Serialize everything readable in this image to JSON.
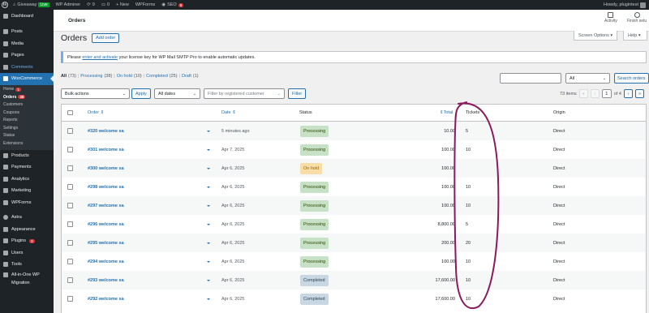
{
  "admin_bar": {
    "site_name": "Giveaway",
    "live_badge": "Live",
    "wp_adminer": "WP Adminer",
    "updates_count": "9",
    "comments_count": "0",
    "new_label": "+ New",
    "wpforms": "WPForms",
    "seo": "SEO",
    "seo_count": "6",
    "howdy": "Howdy, plugintest"
  },
  "sidebar": {
    "items": [
      {
        "label": "Dashboard"
      },
      {
        "label": "Posts"
      },
      {
        "label": "Media"
      },
      {
        "label": "Pages"
      },
      {
        "label": "Comments"
      },
      {
        "label": "WooCommerce"
      },
      {
        "label": "Products"
      },
      {
        "label": "Payments"
      },
      {
        "label": "Analytics"
      },
      {
        "label": "Marketing"
      },
      {
        "label": "WPForms"
      },
      {
        "label": "Astra"
      },
      {
        "label": "Appearance"
      },
      {
        "label": "Plugins"
      },
      {
        "label": "Users"
      },
      {
        "label": "Tools"
      },
      {
        "label": "All-in-One WP"
      },
      {
        "label": "Migration"
      }
    ],
    "woo_sub": [
      {
        "label": "Home",
        "badge": "1"
      },
      {
        "label": "Orders",
        "badge": "38"
      },
      {
        "label": "Customers"
      },
      {
        "label": "Coupons"
      },
      {
        "label": "Reports"
      },
      {
        "label": "Settings"
      },
      {
        "label": "Status"
      },
      {
        "label": "Extensions"
      }
    ],
    "plugins_badge": "3",
    "comments_badge": "0"
  },
  "header": {
    "title": "Orders",
    "activity": "Activity",
    "finish_setup": "Finish setu"
  },
  "screen_options": "Screen Options ▾",
  "help": "Help ▾",
  "page": {
    "heading": "Orders",
    "add_order": "Add order"
  },
  "notice": {
    "prefix": "Please ",
    "link1": "enter and activate",
    "suffix": " your license key for WP Mail SMTP Pro to enable automatic updates."
  },
  "filters": {
    "all": "All",
    "all_count": "(73)",
    "processing": "Processing",
    "processing_count": "(38)",
    "on_hold": "On hold",
    "on_hold_count": "(10)",
    "completed": "Completed",
    "completed_count": "(25)",
    "draft": "Draft",
    "draft_count": "(1)",
    "search_placeholder": "",
    "status_select": "All",
    "search_button": "Search orders",
    "bulk_actions": "Bulk actions",
    "apply": "Apply",
    "all_dates": "All dates",
    "customer_placeholder": "Filter by registered customer",
    "filter_button": "Filter"
  },
  "pagination": {
    "items": "73 items",
    "first": "«",
    "prev": "‹",
    "current": "1",
    "of": "of 4",
    "next": "›",
    "last": "»"
  },
  "table": {
    "columns": {
      "order": "Order",
      "date": "Date",
      "status": "Status",
      "total": "Total",
      "tickets": "Tickets",
      "origin": "Origin"
    },
    "rows": [
      {
        "order": "#320 welcome sa",
        "date": "5 minutes ago",
        "status": "Processing",
        "total": "10.00",
        "tickets": "5",
        "origin": "Direct"
      },
      {
        "order": "#301 welcome sa",
        "date": "Apr 7, 2025",
        "status": "Processing",
        "total": "100.00",
        "tickets": "10",
        "origin": "Direct"
      },
      {
        "order": "#300 welcome sa",
        "date": "Apr 6, 2025",
        "status": "On hold",
        "total": "100.00",
        "tickets": "",
        "origin": "Direct"
      },
      {
        "order": "#298 welcome sa",
        "date": "Apr 6, 2025",
        "status": "Processing",
        "total": "100.00",
        "tickets": "10",
        "origin": "Direct"
      },
      {
        "order": "#297 welcome sa",
        "date": "Apr 6, 2025",
        "status": "Processing",
        "total": "100.00",
        "tickets": "10",
        "origin": "Direct"
      },
      {
        "order": "#296 welcome sa",
        "date": "Apr 6, 2025",
        "status": "Processing",
        "total": "8,800.00",
        "tickets": "5",
        "origin": "Direct"
      },
      {
        "order": "#295 welcome sa",
        "date": "Apr 6, 2025",
        "status": "Processing",
        "total": "200.00",
        "tickets": "20",
        "origin": "Direct"
      },
      {
        "order": "#294 welcome sa",
        "date": "Apr 6, 2025",
        "status": "Processing",
        "total": "100.00",
        "tickets": "10",
        "origin": "Direct"
      },
      {
        "order": "#293 welcome sa",
        "date": "Apr 6, 2025",
        "status": "Completed",
        "total": "17,600.00",
        "tickets": "10",
        "origin": "Direct"
      },
      {
        "order": "#292 welcome sa",
        "date": "Apr 6, 2025",
        "status": "Completed",
        "total": "17,600.00",
        "tickets": "10",
        "origin": "Direct"
      }
    ]
  },
  "colors": {
    "processing_bg": "#c6e1c6",
    "processing_fg": "#2c4700",
    "onhold_bg": "#f8dda7",
    "onhold_fg": "#94660c",
    "completed_bg": "#c8d7e1",
    "completed_fg": "#2e4453",
    "annotation": "#8b1a5c"
  }
}
